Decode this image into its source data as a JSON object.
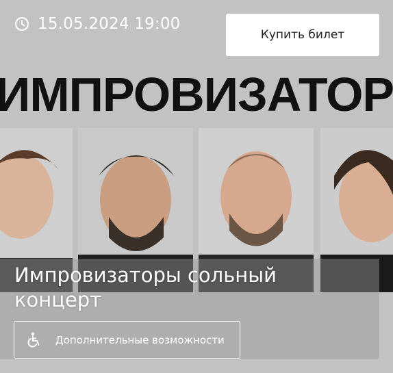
{
  "event": {
    "datetime": "15.05.2024 19:00",
    "buy_label": "Купить билет",
    "banner_text": "ИМПРОВИЗАТОР",
    "title": "Импровизаторы сольный концерт",
    "accessibility_label": "Дополнительные возможности"
  },
  "icons": [
    "clock-icon",
    "wheelchair-icon"
  ],
  "colors": {
    "card_background": "#c2c2c2",
    "button_background": "#ffffff",
    "banner_text": "#111111",
    "overlay_text": "#ffffff"
  }
}
